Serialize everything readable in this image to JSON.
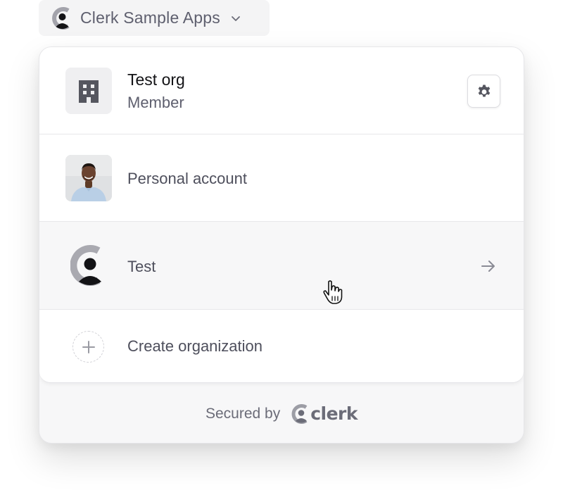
{
  "trigger": {
    "label": "Clerk Sample Apps",
    "logo_icon": "clerk-logo-icon",
    "chevron_icon": "chevron-down-icon"
  },
  "active_organization": {
    "name": "Test org",
    "role": "Member",
    "avatar_icon": "building-icon",
    "settings_icon": "gear-icon"
  },
  "personal_account": {
    "label": "Personal account",
    "avatar": "user-photo"
  },
  "other_organizations": [
    {
      "label": "Test",
      "logo_icon": "clerk-logo-icon",
      "action_icon": "arrow-right-icon"
    }
  ],
  "create_organization": {
    "label": "Create organization",
    "icon": "plus-icon"
  },
  "footer": {
    "secured_label": "Secured by",
    "brand": "clerk"
  },
  "colors": {
    "text_primary": "#131316",
    "text_secondary": "#5e5f6e",
    "footer_bg": "#f7f7f8",
    "trigger_bg": "#f4f4f5"
  }
}
